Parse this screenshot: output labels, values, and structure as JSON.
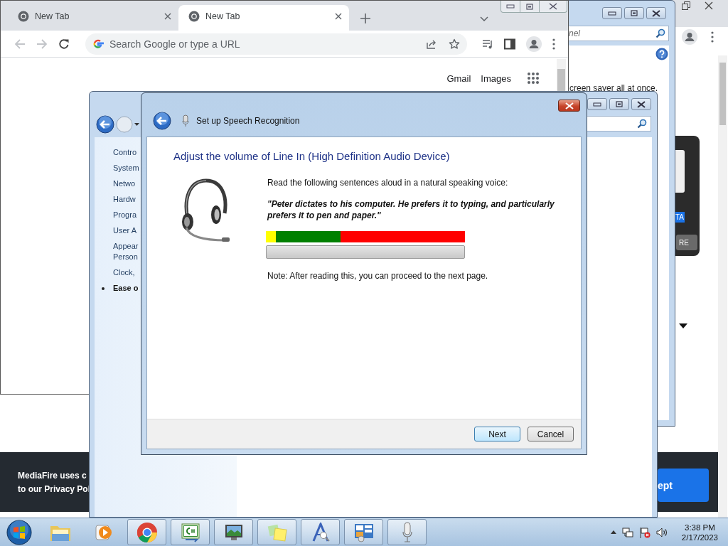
{
  "background_browser": {
    "card": {
      "badge": "TA",
      "button": "RE"
    },
    "banner": {
      "lines": [
        "MediaFire uses c",
        "to our Privacy Pol"
      ],
      "button": "ept"
    }
  },
  "control_panel_behind": {
    "search": {
      "placeholder": "nel"
    },
    "text": "creen saver all at once."
  },
  "browser": {
    "tabs": [
      {
        "title": "New Tab",
        "selected": false
      },
      {
        "title": "New Tab",
        "selected": true
      }
    ],
    "omnibox": {
      "placeholder": "Search Google or type a URL"
    },
    "links": [
      "Gmail",
      "Images"
    ]
  },
  "control_panel": {
    "nav": [
      {
        "label": "Contro",
        "selected": false
      },
      {
        "label": "System",
        "selected": false
      },
      {
        "label": "Netwo",
        "selected": false
      },
      {
        "label": "Hardw",
        "selected": false
      },
      {
        "label": "Progra",
        "selected": false
      },
      {
        "label": "User A",
        "selected": false
      },
      {
        "label": "Appear\nPerson",
        "selected": false
      },
      {
        "label": "Clock,",
        "selected": false
      },
      {
        "label": "Ease o",
        "selected": true
      }
    ]
  },
  "dialog": {
    "title": "Set up Speech Recognition",
    "heading": "Adjust the volume of Line In (High Definition Audio Device)",
    "instruction": "Read the following sentences aloud in a natural speaking voice:",
    "quote": "\"Peter dictates to his computer. He prefers it to typing, and particularly prefers it to pen and paper.\"",
    "meter": {
      "level": 0
    },
    "note": "Note: After reading this, you can proceed to the next page.",
    "buttons": [
      {
        "label": "Next",
        "default": true
      },
      {
        "label": "Cancel",
        "default": false
      }
    ]
  },
  "taskbar": {
    "apps": [
      {
        "kind": "folder",
        "running": false
      },
      {
        "kind": "media",
        "running": false
      },
      {
        "kind": "chrome",
        "running": true
      },
      {
        "kind": "csharp",
        "running": true
      },
      {
        "kind": "monitor",
        "running": true
      },
      {
        "kind": "notes",
        "running": true
      },
      {
        "kind": "font",
        "running": true
      },
      {
        "kind": "panel",
        "running": true
      },
      {
        "kind": "microphone",
        "running": true
      }
    ],
    "clock": {
      "time": "3:38 PM",
      "date": "2/17/2023"
    }
  }
}
